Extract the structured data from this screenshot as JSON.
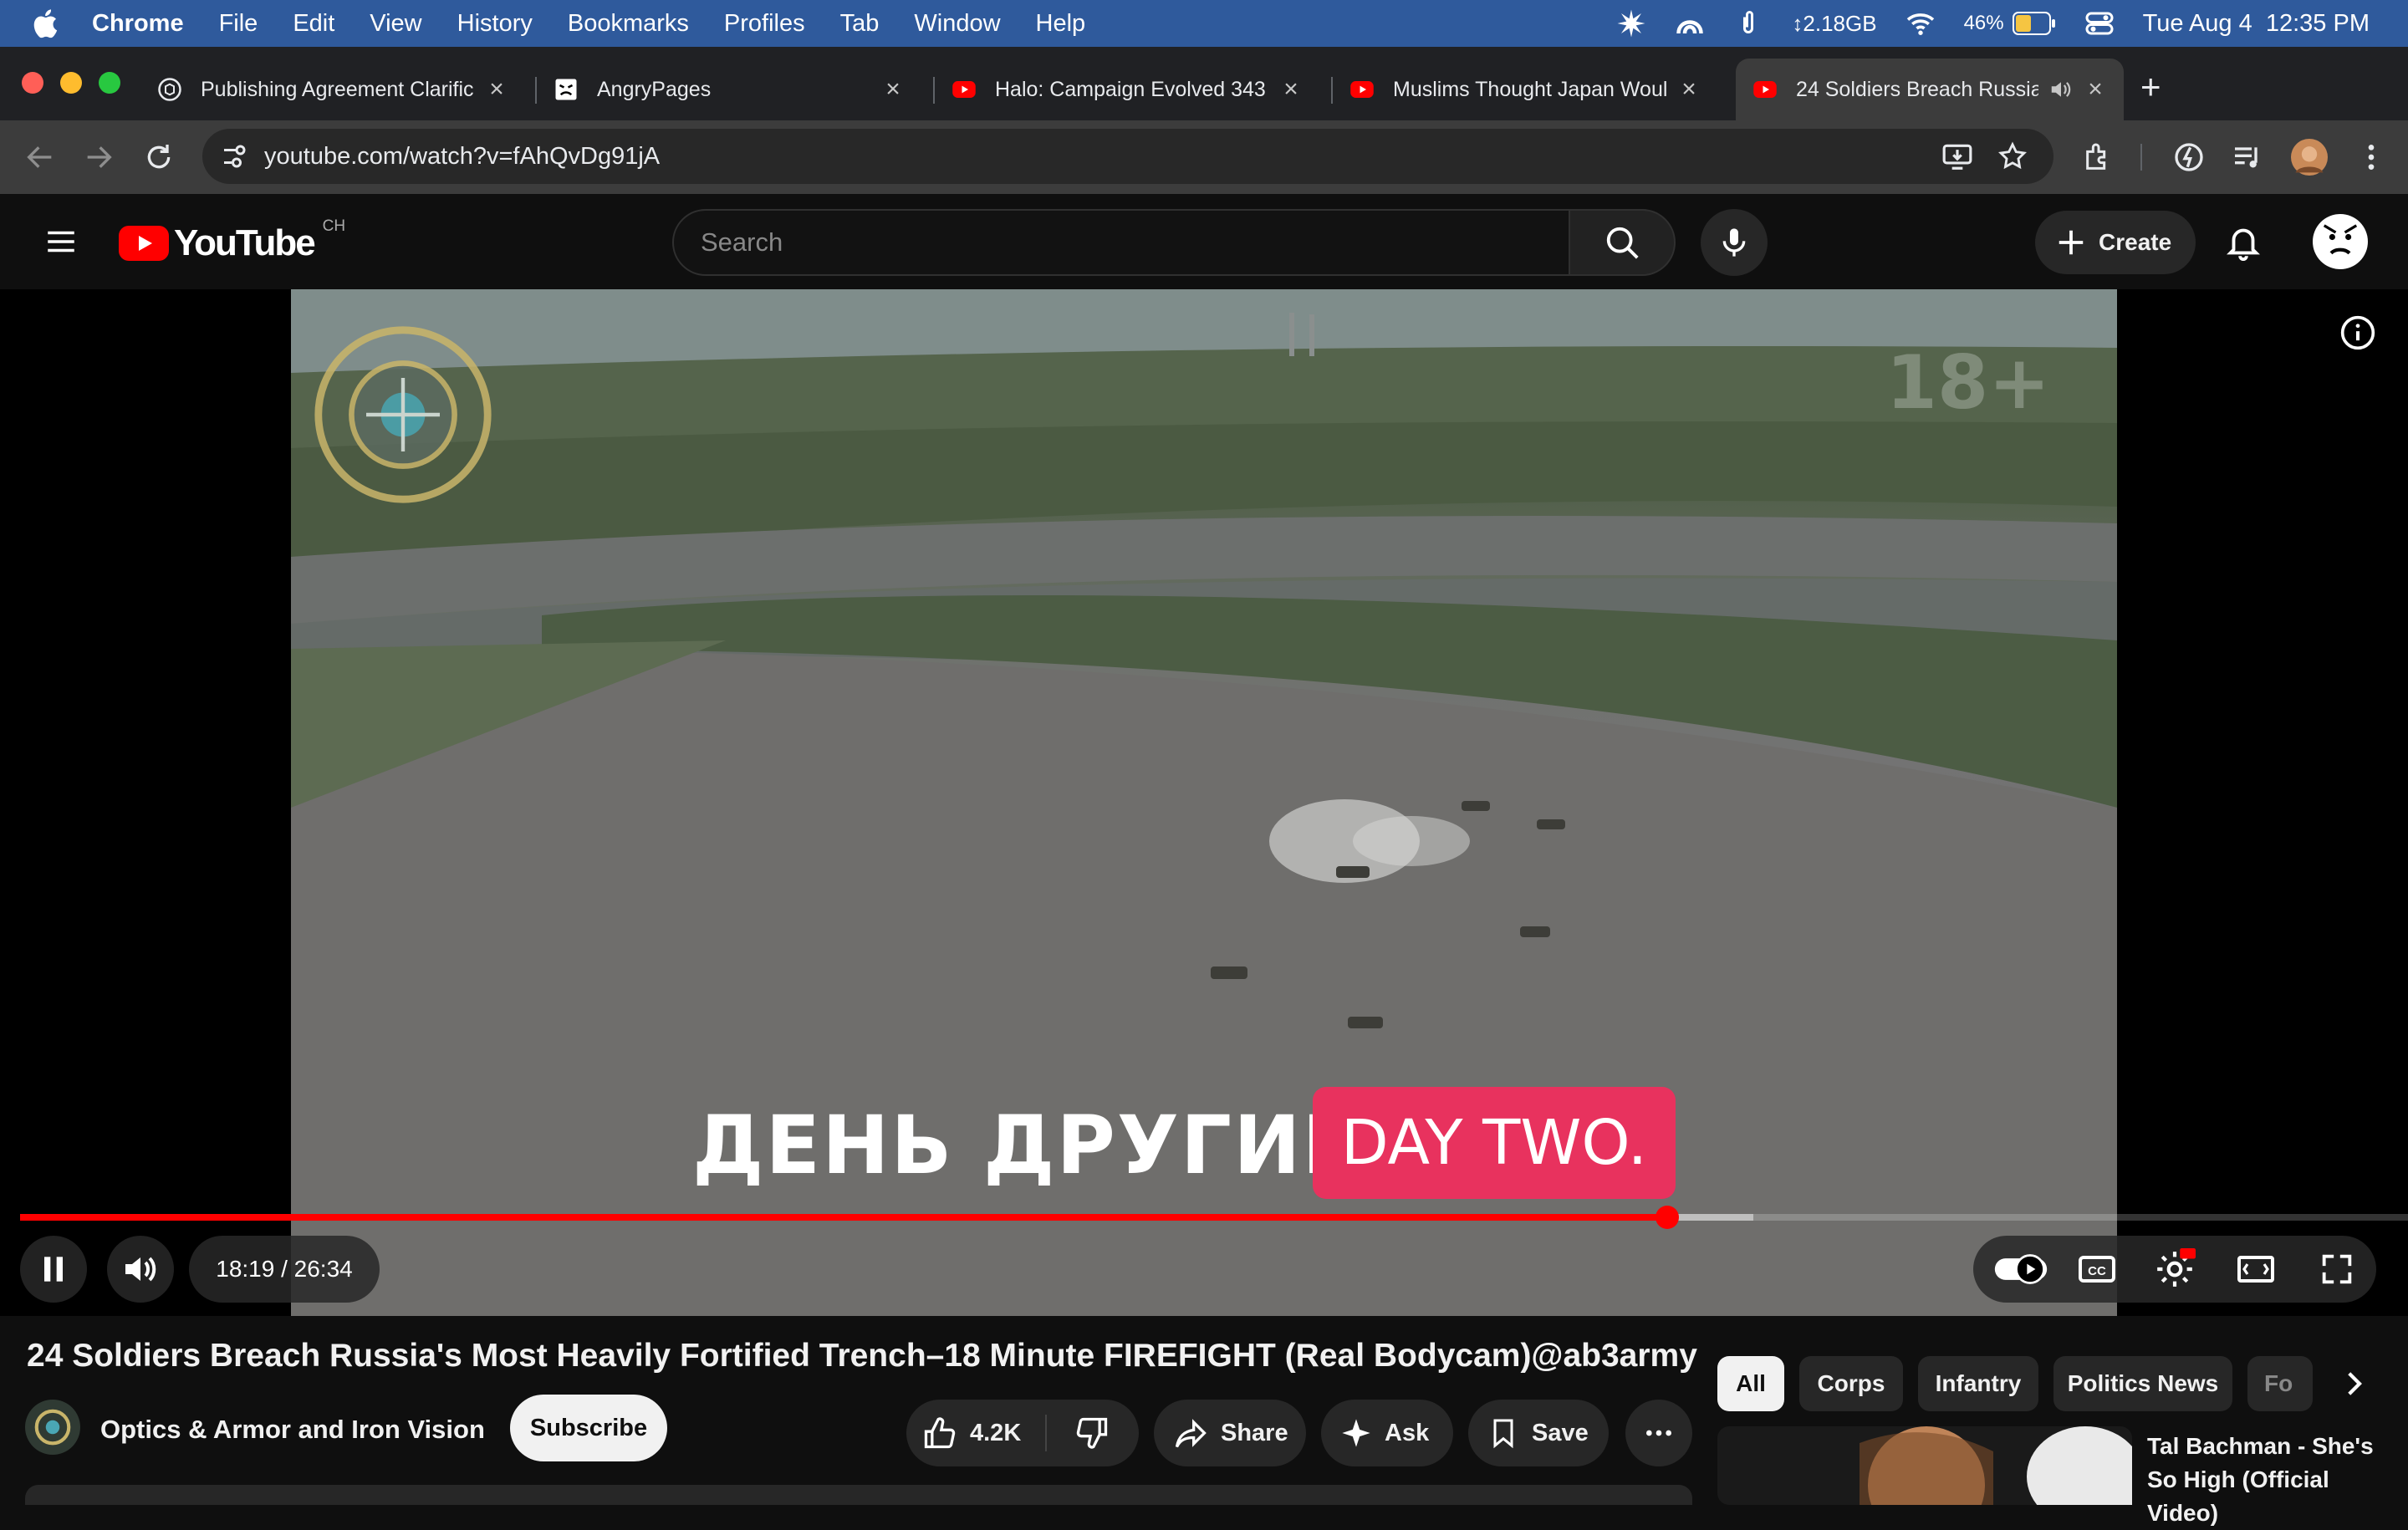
{
  "menubar": {
    "app": "Chrome",
    "items": [
      "File",
      "Edit",
      "View",
      "History",
      "Bookmarks",
      "Profiles",
      "Tab",
      "Window",
      "Help"
    ],
    "memory": "↕2.18GB",
    "battery": "46%",
    "datetime": "Tue Aug 4  12:35 PM"
  },
  "tabs": [
    {
      "title": "Publishing Agreement Clarific",
      "icon": "chatgpt-icon"
    },
    {
      "title": "AngryPages",
      "icon": "angrypages-icon"
    },
    {
      "title": "Halo: Campaign Evolved 343",
      "icon": "youtube-icon"
    },
    {
      "title": "Muslims Thought Japan Woul",
      "icon": "youtube-icon"
    },
    {
      "title": "24 Soldiers Breach Russia",
      "icon": "youtube-icon",
      "active": true
    }
  ],
  "toolbar": {
    "url": "youtube.com/watch?v=fAhQvDg91jA"
  },
  "youtube": {
    "logo_text": "YouTube",
    "country": "CH",
    "search_placeholder": "Search",
    "create_label": "Create"
  },
  "player": {
    "subtitle_ru": "ДЕНЬ ДРУГИЙ",
    "subtitle_en": "DAY TWO.",
    "rating_watermark": "18+",
    "time_current": "18:19",
    "time_total": "26:34",
    "time_display": "18:19 / 26:34",
    "played_fraction": 0.6897,
    "buffered_fraction": 0.7258
  },
  "video": {
    "title": "24 Soldiers Breach Russia's Most Heavily Fortified Trench–18 Minute FIREFIGHT (Real Bodycam)@ab3army",
    "channel": "Optics & Armor and Iron Vision",
    "subscribe_label": "Subscribe",
    "likes": "4.2K",
    "share_label": "Share",
    "ask_label": "Ask",
    "save_label": "Save"
  },
  "chips": [
    "All",
    "Corps",
    "Infantry",
    "Politics News",
    "Fo"
  ],
  "recommendation": {
    "title_line1": "Tal Bachman - She's",
    "title_line2": "So High (Official",
    "title_line3": "Video)"
  },
  "colors": {
    "accent_red": "#ff0000",
    "subtitle_pink": "#e8325e",
    "menubar_blue": "#2f5a9c"
  }
}
